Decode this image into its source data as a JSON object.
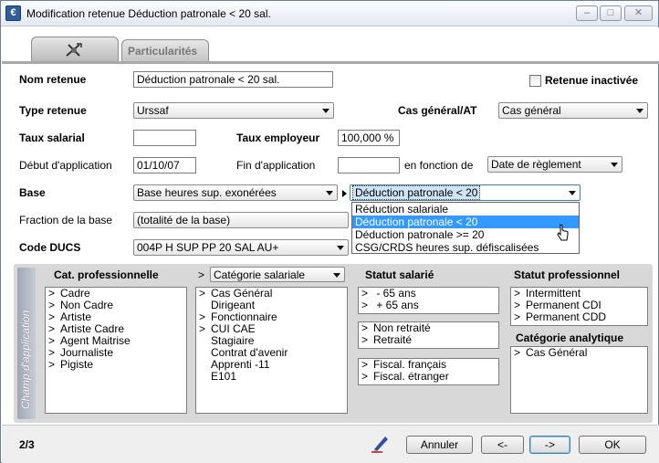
{
  "window": {
    "title": "Modification retenue Déduction patronale < 20 sal.",
    "app_icon_glyph": "€"
  },
  "titlebar": {
    "minimize": "–",
    "maximize": "□",
    "close": "✕"
  },
  "tabs": [
    {
      "label": "",
      "icon": "gear-tools-icon"
    },
    {
      "label": "Particularités"
    }
  ],
  "form": {
    "nom_retenue_label": "Nom retenue",
    "nom_retenue_value": "Déduction patronale < 20 sal.",
    "retenue_inactivee_label": "Retenue inactivée",
    "type_retenue_label": "Type retenue",
    "type_retenue_value": "Urssaf",
    "cas_general_label": "Cas général/AT",
    "cas_general_value": "Cas général",
    "taux_salarial_label": "Taux salarial",
    "taux_salarial_value": "",
    "taux_employeur_label": "Taux employeur",
    "taux_employeur_value": "100,000 %",
    "debut_label": "Début d'application",
    "debut_value": "01/10/07",
    "fin_label": "Fin d'application",
    "fin_value": "",
    "en_fonction_label": "en fonction de",
    "en_fonction_value": "Date de règlement",
    "base_label": "Base",
    "base_value": "Base heures sup. exonérées",
    "base2_value": "Déduction patronale < 20",
    "base2_options": [
      "Réduction salariale",
      "Déduction patronale < 20",
      "Déduction patronale >= 20",
      "CSG/CRDS heures sup. défiscalisées"
    ],
    "base2_highlighted_index": 1,
    "fraction_label": "Fraction de la base",
    "fraction_value": "(totalité de la base)",
    "code_ducs_label": "Code DUCS",
    "code_ducs_value": "004P   H SUP PP 20 SAL AU+"
  },
  "champ": {
    "side_label": "Champ d'application",
    "cat_pro_header": "Cat. professionnelle",
    "cat_pro_items": [
      {
        "mark": ">",
        "label": "Cadre"
      },
      {
        "mark": ">",
        "label": "Non Cadre"
      },
      {
        "mark": ">",
        "label": "Artiste"
      },
      {
        "mark": ">",
        "label": "Artiste Cadre"
      },
      {
        "mark": ">",
        "label": "Agent Maitrise"
      },
      {
        "mark": ">",
        "label": "Journaliste"
      },
      {
        "mark": ">",
        "label": "Pigiste"
      }
    ],
    "cat_sal_marker": ">",
    "cat_sal_select": "Catégorie salariale",
    "cat_sal_items": [
      {
        "mark": ">",
        "label": "Cas Général"
      },
      {
        "mark": "",
        "label": "Dirigeant"
      },
      {
        "mark": ">",
        "label": "Fonctionnaire"
      },
      {
        "mark": ">",
        "label": "CUI CAE"
      },
      {
        "mark": "",
        "label": "Stagiaire"
      },
      {
        "mark": "",
        "label": "Contrat d'avenir"
      },
      {
        "mark": "",
        "label": "Apprenti -11"
      },
      {
        "mark": "",
        "label": "E101"
      }
    ],
    "statut_salarie_header": "Statut salarié",
    "statut_age": [
      {
        "mark": ">",
        "label": " - 65 ans"
      },
      {
        "mark": ">",
        "label": " + 65 ans"
      }
    ],
    "statut_retraite": [
      {
        "mark": ">",
        "label": "Non retraité"
      },
      {
        "mark": ">",
        "label": "Retraité"
      }
    ],
    "statut_fiscal": [
      {
        "mark": ">",
        "label": "Fiscal. français"
      },
      {
        "mark": ">",
        "label": "Fiscal. étranger"
      }
    ],
    "statut_pro_header": "Statut professionnel",
    "statut_pro_items": [
      {
        "mark": ">",
        "label": "Intermittent"
      },
      {
        "mark": ">",
        "label": "Permanent CDI"
      },
      {
        "mark": ">",
        "label": "Permanent CDD"
      }
    ],
    "cat_analytique_header": "Catégorie analytique",
    "cat_analytique_items": [
      {
        "mark": ">",
        "label": "Cas Général"
      }
    ]
  },
  "footer": {
    "page": "2/3",
    "annuler": "Annuler",
    "prev": "<-",
    "next": "->",
    "ok": "OK"
  }
}
